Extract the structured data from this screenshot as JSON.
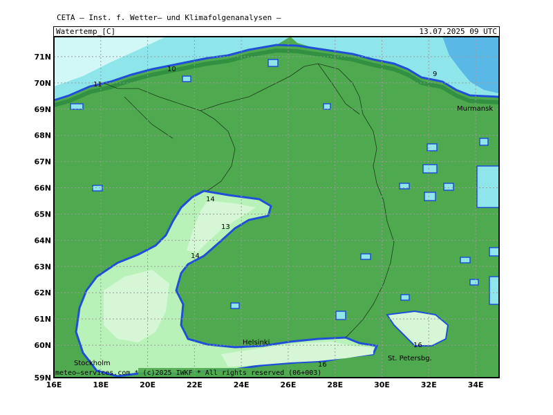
{
  "header": {
    "title": "CETA — Inst. f. Wetter— und Klimafolgenanalysen —",
    "variable": "Watertemp_[C]",
    "timestamp": "13.07.2025 09 UTC"
  },
  "map": {
    "lat_range": [
      59,
      72
    ],
    "lon_range": [
      16,
      35
    ],
    "lat_ticks": [
      "71N",
      "70N",
      "69N",
      "68N",
      "67N",
      "66N",
      "65N",
      "64N",
      "63N",
      "62N",
      "61N",
      "60N",
      "59N"
    ],
    "lon_ticks": [
      "16E",
      "18E",
      "20E",
      "22E",
      "24E",
      "26E",
      "28E",
      "30E",
      "32E",
      "34E"
    ],
    "contour_labels": [
      "10",
      "11",
      "9",
      "14",
      "13",
      "14",
      "16",
      "16"
    ],
    "cities": [
      "Murmansk",
      "Helsinki",
      "Stockholm",
      "St. Petersbg."
    ],
    "colors": {
      "land": "#4faa4f",
      "sea_cold": "#8ee6ea",
      "sea_deep": "#5ab8e6",
      "water_warm": "#b8f2b8",
      "water_warmer": "#d6f7d6",
      "coast_blue": "#1f4fd6",
      "coast_dark": "#2b8a3e",
      "border": "#1a3a1a"
    }
  },
  "footer": {
    "credit": "meteo—services.com * (c)2025 IWKF * All rights reserved (06+003)"
  }
}
